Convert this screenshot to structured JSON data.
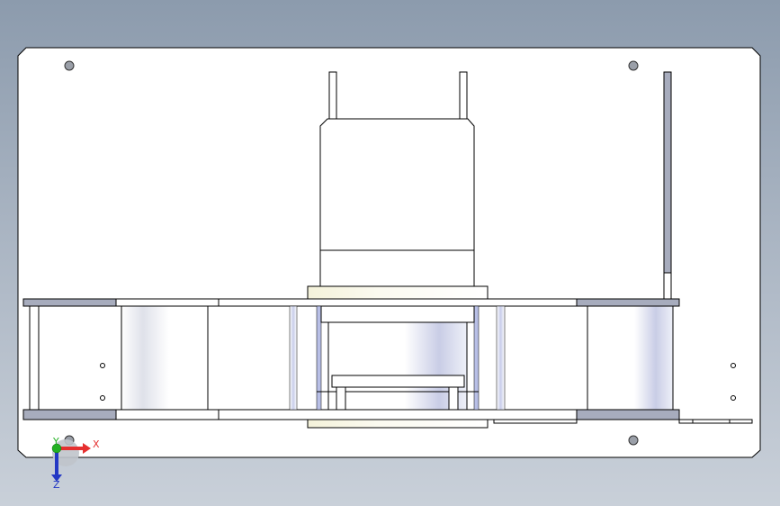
{
  "viewport": {
    "background_top": "#8c9bad",
    "background_bottom": "#c9d0d9"
  },
  "drawing": {
    "sheet_color": "#ffffff",
    "line_color": "#000000",
    "steel_color": "#a7acbd",
    "roller_color": "#cfd3e6",
    "brass_color": "#ecebc8"
  },
  "triad": {
    "x_label": "X",
    "y_label": "Y",
    "z_label": "Z",
    "x_color": "#e53030",
    "y_color": "#23b123",
    "z_color": "#2338c4"
  }
}
